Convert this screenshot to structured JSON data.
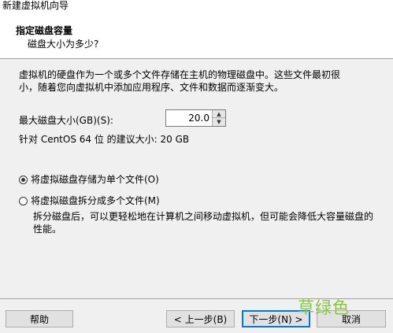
{
  "window": {
    "title": "新建虚拟机向导"
  },
  "header": {
    "title": "指定磁盘容量",
    "subtitle": "磁盘大小为多少?"
  },
  "description": {
    "line1": "虚拟机的硬盘作为一个或多个文件存储在主机的物理磁盘中。这些文件最初很",
    "line2": "小，随着您向虚拟机中添加应用程序、文件和数据而逐渐变大。"
  },
  "disk_size": {
    "label": "最大磁盘大小(GB)(S):",
    "value": "20.0",
    "recommendation": "针对 CentOS 64 位 的建议大小: 20 GB"
  },
  "options": {
    "single_file": {
      "label": "将虚拟磁盘存储为单个文件(O)",
      "selected": true
    },
    "multiple_files": {
      "label": "将虚拟磁盘拆分成多个文件(M)",
      "selected": false
    },
    "multiple_desc_line1": "拆分磁盘后，可以更轻松地在计算机之间移动虚拟机，但可能会降低大容量磁盘的",
    "multiple_desc_line2": "性能。"
  },
  "buttons": {
    "help": "帮助",
    "back": "< 上一步(B)",
    "next": "下一步(N) >",
    "cancel": "取消"
  },
  "watermark": "草绿色"
}
